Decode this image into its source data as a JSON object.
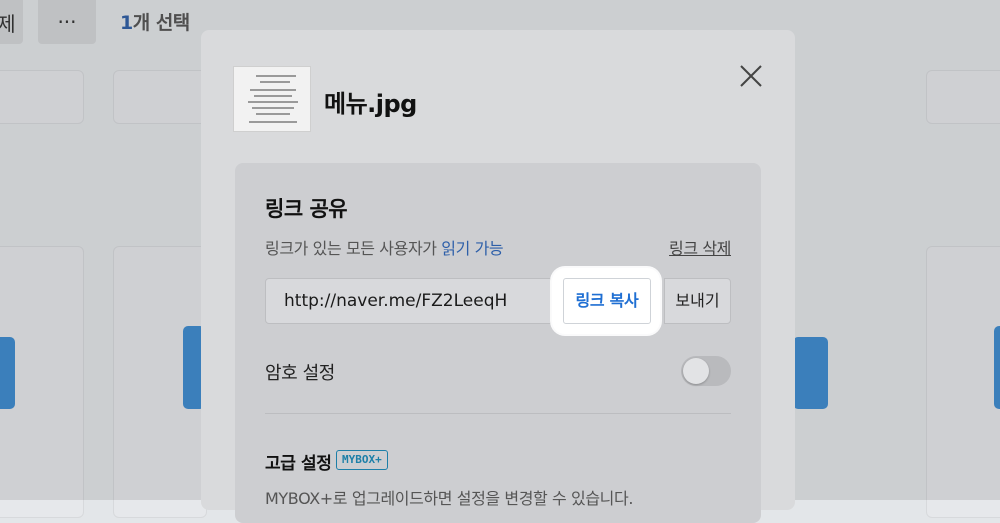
{
  "background": {
    "left_button_label": "제",
    "more_button_label": "···",
    "selection": {
      "count": "1",
      "suffix": "개 선택"
    }
  },
  "modal": {
    "filename": "메뉴.jpg",
    "close_icon": "close-icon",
    "link_share": {
      "title": "링크 공유",
      "permission_prefix": "링크가 있는 모든 사용자가 ",
      "permission_link": "읽기 가능",
      "delete_label": "링크 삭제",
      "url": "http://naver.me/FZ2LeeqH",
      "copy_label": "링크 복사",
      "send_label": "보내기"
    },
    "password": {
      "label": "암호 설정",
      "enabled": false
    },
    "advanced": {
      "title": "고급 설정",
      "badge": "MYBOX+",
      "description": "MYBOX+로 업그레이드하면 설정을 변경할 수 있습니다."
    }
  },
  "colors": {
    "accent_blue": "#1f6fd3",
    "link_blue": "#2d5fa9",
    "badge_teal": "#1c7fa8",
    "background_bar_blue": "#3e8bd0"
  }
}
